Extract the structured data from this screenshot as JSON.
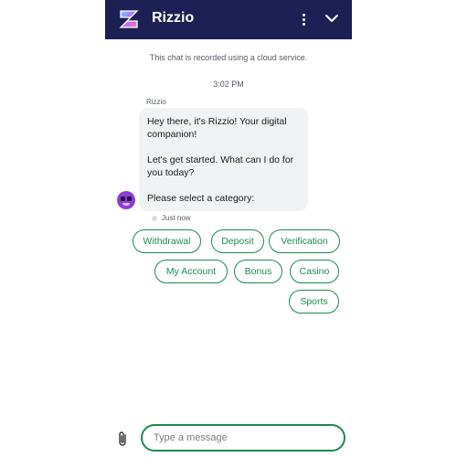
{
  "header": {
    "title": "Rizzio",
    "logo_icon": "rizzio-z-logo",
    "menu_icon": "kebab-menu-icon",
    "collapse_icon": "chevron-down-icon",
    "background": "#1d2054"
  },
  "chat": {
    "notice": "This chat is recorded using a cloud service.",
    "timestamp": "3:02 PM",
    "sender": "Rizzio",
    "message": {
      "line1": "Hey there, it's Rizzio! Your digital companion!",
      "line2": "Let's get started. What can I do for you today?",
      "line3": "Please select a category:"
    },
    "status": "Just now"
  },
  "quick_replies": [
    "Withdrawal",
    "Deposit",
    "Verification",
    "My Account",
    "Bonus",
    "Casino",
    "Sports"
  ],
  "composer": {
    "placeholder": "Type a message",
    "attach_icon": "paperclip-icon"
  },
  "colors": {
    "accent": "#1e8a4d",
    "bubble": "#f1f2f4"
  }
}
